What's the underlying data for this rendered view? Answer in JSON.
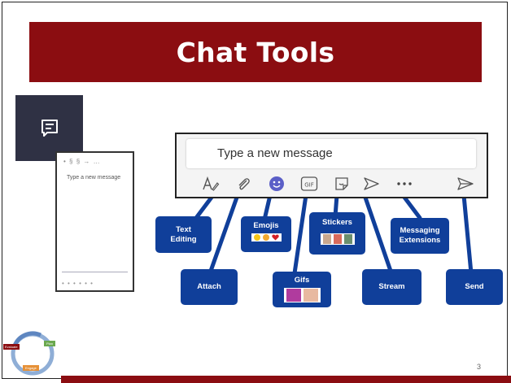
{
  "slide": {
    "title": "Chat Tools",
    "page_number": "3"
  },
  "chat_box": {
    "placeholder": "Type a new message"
  },
  "mini_pane": {
    "toolbar_glyphs": "• § § → …",
    "placeholder": "Type a new message",
    "bottom_glyphs": "• • • • • •"
  },
  "tools": [
    {
      "icon": "text-format-icon"
    },
    {
      "icon": "paperclip-icon"
    },
    {
      "icon": "emoji-icon"
    },
    {
      "icon": "gif-icon",
      "label": "GIF"
    },
    {
      "icon": "sticker-icon"
    },
    {
      "icon": "stream-icon"
    },
    {
      "icon": "more-icon"
    },
    {
      "icon": "send-icon"
    }
  ],
  "callouts": {
    "text_editing": "Text Editing",
    "emojis": "Emojis",
    "stickers": "Stickers",
    "messaging_extensions": "Messaging Extensions",
    "attach": "Attach",
    "gifs": "Gifs",
    "stream": "Stream",
    "send": "Send"
  },
  "cycle_logo": {
    "labels": [
      "Evaluate",
      "Plan",
      "Engage"
    ]
  },
  "colors": {
    "brand_red": "#8b0d11",
    "callout_blue": "#103f9a",
    "teams_purple": "#5b5fc7",
    "tile_dark": "#2f3144"
  }
}
